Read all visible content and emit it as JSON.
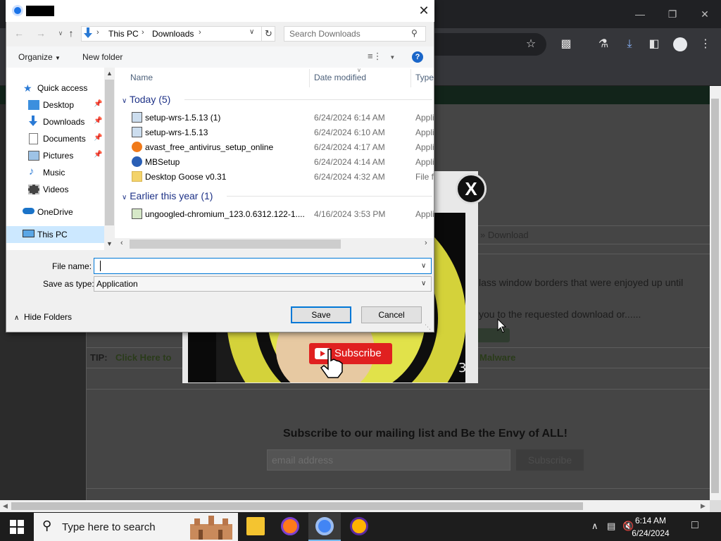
{
  "dialog": {
    "address": {
      "segments": [
        "This PC",
        "Downloads"
      ]
    },
    "search_placeholder": "Search Downloads",
    "commands": {
      "organize": "Organize",
      "new_folder": "New folder"
    },
    "nav": {
      "quick_access": "Quick access",
      "items": [
        "Desktop",
        "Downloads",
        "Documents",
        "Pictures",
        "Music",
        "Videos"
      ],
      "onedrive": "OneDrive",
      "this_pc": "This PC"
    },
    "columns": {
      "name": "Name",
      "date": "Date modified",
      "type": "Type"
    },
    "groups": [
      {
        "label": "Today (5)",
        "files": [
          {
            "name": "setup-wrs-1.5.13 (1)",
            "date": "6/24/2024 6:14 AM",
            "type": "Application",
            "icon": "installer-icon"
          },
          {
            "name": "setup-wrs-1.5.13",
            "date": "6/24/2024 6:10 AM",
            "type": "Application",
            "icon": "installer-icon"
          },
          {
            "name": "avast_free_antivirus_setup_online",
            "date": "6/24/2024 4:17 AM",
            "type": "Application",
            "icon": "avast-icon"
          },
          {
            "name": "MBSetup",
            "date": "6/24/2024 4:14 AM",
            "type": "Application",
            "icon": "malwarebytes-icon"
          },
          {
            "name": "Desktop Goose v0.31",
            "date": "6/24/2024 4:32 AM",
            "type": "File folder",
            "icon": "folder-icon"
          }
        ]
      },
      {
        "label": "Earlier this year (1)",
        "files": [
          {
            "name": "ungoogled-chromium_123.0.6312.122-1....",
            "date": "4/16/2024 3:53 PM",
            "type": "Application",
            "icon": "installer-icon"
          }
        ]
      }
    ],
    "file_name_label": "File name:",
    "file_name_value": "",
    "save_type_label": "Save as type:",
    "save_type_value": "Application",
    "hide_folders": "Hide Folders",
    "save": "Save",
    "cancel": "Cancel"
  },
  "popup": {
    "close": "X",
    "subscribe": "Subscribe"
  },
  "page": {
    "breadcrumb_tail": "» Download",
    "line1": "lass window borders that were enjoyed up until",
    "line2": "you to the requested download or......",
    "tip_label": "TIP:",
    "tip_link": "Click Here to",
    "tip_tail": "Malware",
    "mailing_heading": "Subscribe to our mailing list and Be the Envy of ALL!",
    "email_placeholder": "email address",
    "subscribe_button": "Subscribe"
  },
  "taskbar": {
    "search_placeholder": "Type here to search",
    "time": "6:14 AM",
    "date": "6/24/2024"
  },
  "colors": {
    "accent": "#0078d7",
    "selection": "#cce8ff",
    "group_header": "#1e3287",
    "subscribe_red": "#e02020"
  }
}
